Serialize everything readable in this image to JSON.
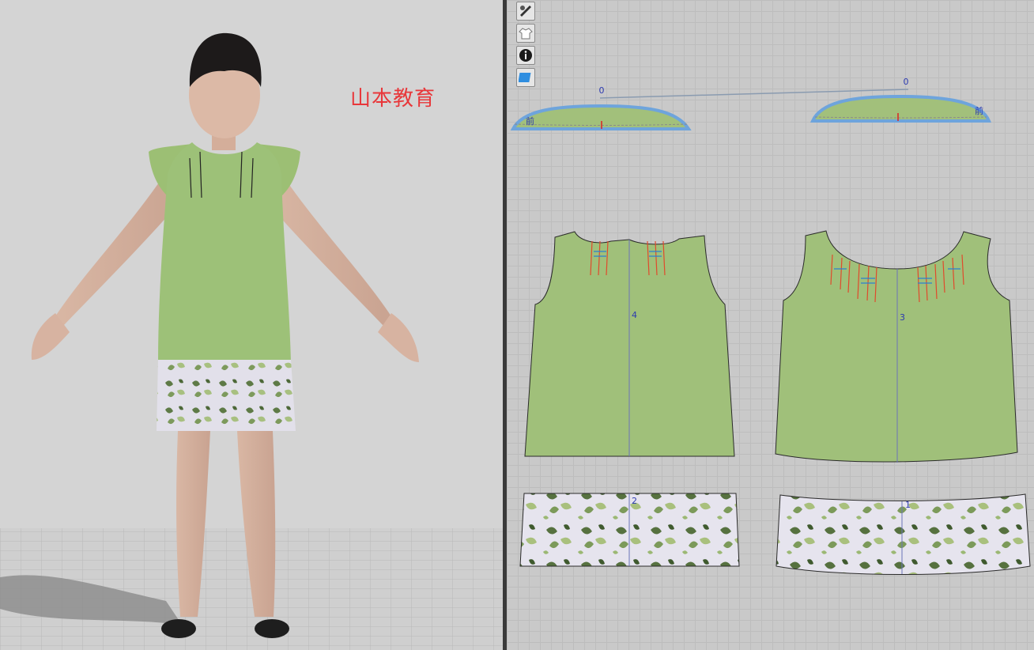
{
  "watermark": "山本教育",
  "toolbar": {
    "tools": [
      "pen-eye-icon",
      "shirt-icon",
      "info-icon",
      "fabric-icon"
    ]
  },
  "pattern_labels": {
    "collar_left_number": "0",
    "collar_right_number": "0",
    "collar_left_tag": "前",
    "collar_right_tag": "前",
    "front_bodice": "4",
    "back_bodice": "3",
    "front_hem_band": "2",
    "back_hem_band": "1"
  },
  "colors": {
    "fabric_green": "#a1c07c",
    "seam_blue": "#6ea4dc",
    "label_blue": "#2b39b0",
    "watermark_red": "#e8373a"
  }
}
